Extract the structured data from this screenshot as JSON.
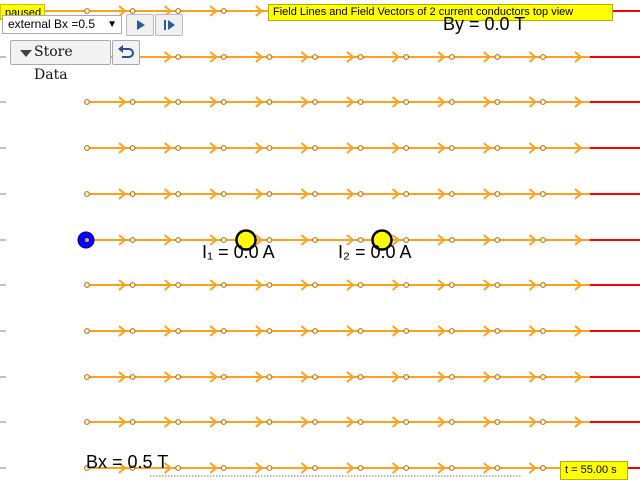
{
  "status": {
    "label": "paused"
  },
  "title": "Field Lines and Field Vectors of 2 current conductors top view",
  "controls": {
    "field_select": "external Bx =0.5",
    "store_button": "Store Data"
  },
  "readouts": {
    "by": "By = 0.0 T",
    "bx": "Bx = 0.5 T",
    "i1": "I₁ = 0.0 A",
    "i2": "I₂ = 0.0 A",
    "time": "t = 55.00 s"
  },
  "icons": [
    "play-icon",
    "step-forward-icon",
    "undo-icon",
    "chevron-down-icon"
  ],
  "colors": {
    "field_line": "#ffa01e",
    "field_line_end": "#ff0000",
    "conductor": "#ffff00",
    "probe": "#0000ff",
    "label_bg": "#ffff00"
  },
  "field": {
    "rows": 11,
    "direction": "right"
  }
}
